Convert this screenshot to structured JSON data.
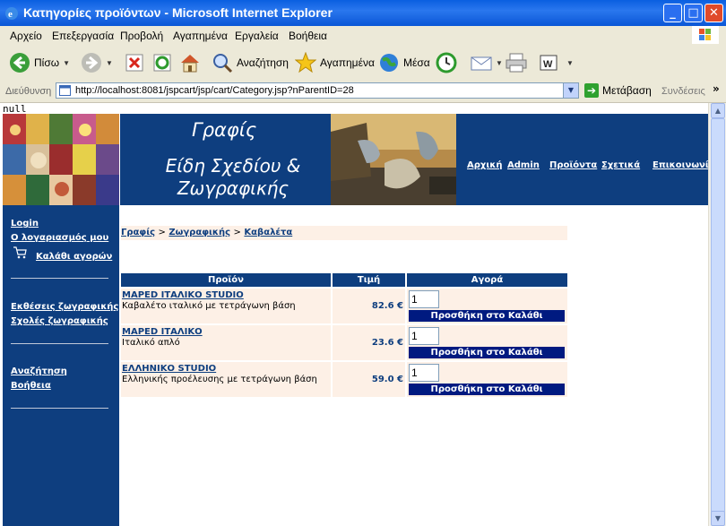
{
  "window": {
    "title": "Κατηγορίες προϊόντων - Microsoft Internet Explorer",
    "minimize": "_",
    "maximize": "□",
    "close": "✕"
  },
  "menubar": [
    "Αρχείο",
    "Επεξεργασία",
    "Προβολή",
    "Αγαπημένα",
    "Εργαλεία",
    "Βοήθεια"
  ],
  "toolbar": {
    "back": "Πίσω",
    "search": "Αναζήτηση",
    "favorites": "Αγαπημένα",
    "media": "Μέσα"
  },
  "address": {
    "label": "Διεύθυνση",
    "url": "http://localhost:8081/jspcart/jsp/cart/Category.jsp?nParentID=28",
    "go": "Μετάβαση",
    "links": "Συνδέσεις"
  },
  "page": {
    "null_text": "null",
    "site_name": "Γραφίς",
    "tagline": "Είδη Σχεδίου & Ζωγραφικής",
    "nav": [
      "Αρχική",
      "Admin",
      "Προϊόντα",
      "Σχετικά",
      "Επικοινωνία"
    ],
    "sidebar": {
      "login": "Login",
      "account": "Ο λογαριασμός μου",
      "cart": "Καλάθι αγορών",
      "exhibitions": "Εκθέσεις ζωγραφικής",
      "schools": "Σχολές ζωγραφικής",
      "search": "Αναζήτηση",
      "help": "Βοήθεια"
    },
    "breadcrumb": [
      "Γραφίς",
      "Ζωγραφικής",
      "Καβαλέτα"
    ],
    "table": {
      "headers": [
        "Προϊόν",
        "Τιμή",
        "Αγορά"
      ],
      "add_label": "Προσθήκη στο Καλάθι",
      "rows": [
        {
          "name": "MAPED ΙΤΑΛΙΚΟ STUDIO",
          "desc": "Καβαλέτο ιταλικό με τετράγωνη βάση",
          "price": "82.6 €",
          "qty": "1"
        },
        {
          "name": "MAPED ΙΤΑΛΙΚΟ",
          "desc": "Ιταλικό απλό",
          "price": "23.6 €",
          "qty": "1"
        },
        {
          "name": "ΕΛΛΗΝΙΚΟ STUDIO",
          "desc": "Ελληνικής προέλευσης με τετράγωνη βάση",
          "price": "59.0 €",
          "qty": "1"
        }
      ]
    }
  }
}
